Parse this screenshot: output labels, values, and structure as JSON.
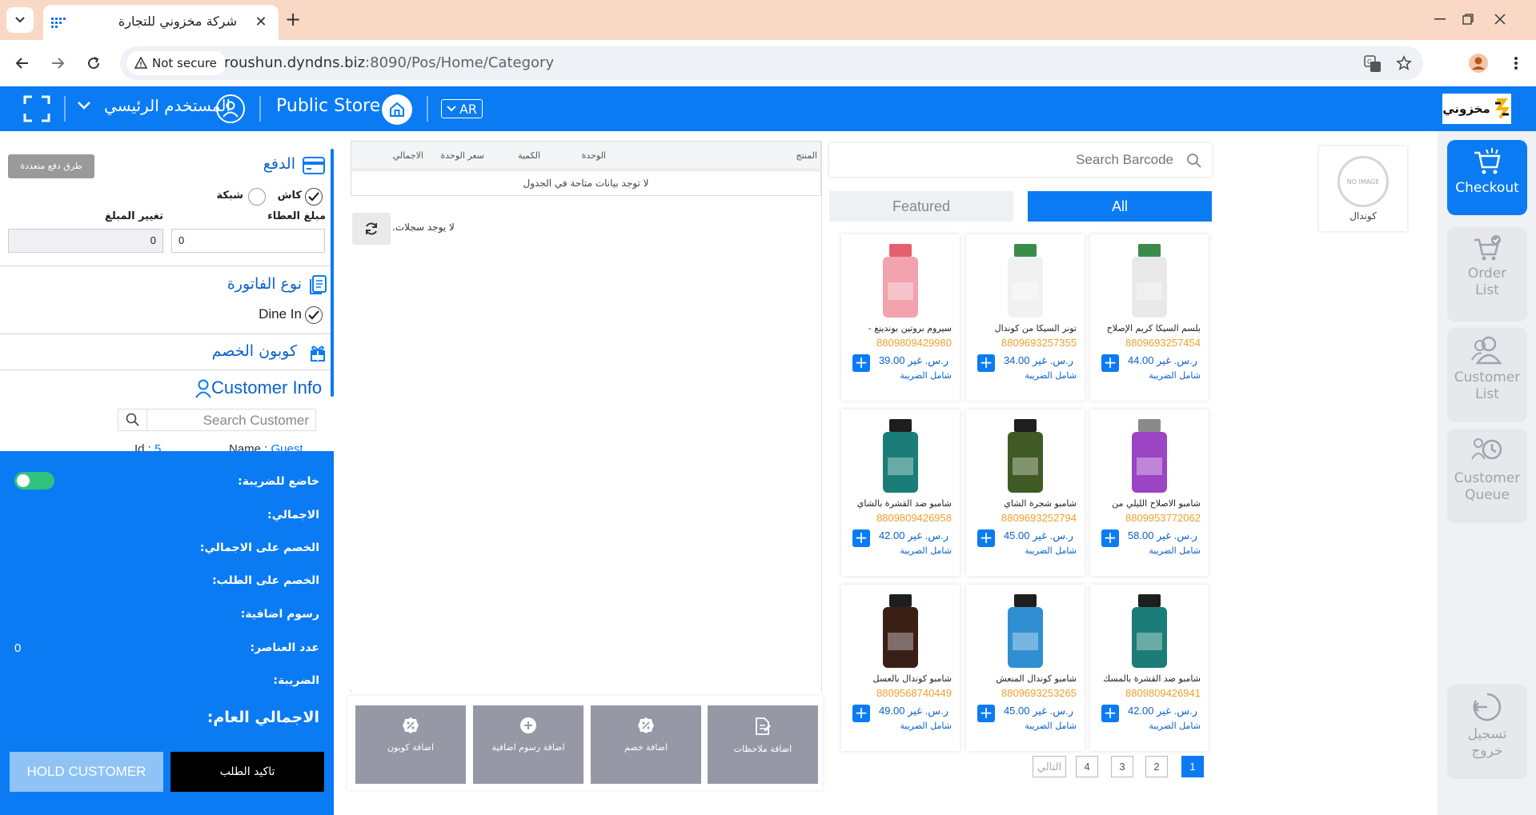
{
  "browser": {
    "tab_title": "شركة مخزوني للتجارة",
    "security_label": "Not secure",
    "url_host": "roushun.dyndns.biz",
    "url_path": ":8090/Pos/Home/Category"
  },
  "header": {
    "user_name": "المستخدم الرئيسي",
    "store_name": "Public Store",
    "language": "AR",
    "brand_name": "مخزوني",
    "accent_color": "#0a7bf3"
  },
  "sidebar": {
    "checkout": "Checkout",
    "order_list_1": "Order",
    "order_list_2": "List",
    "customer_list_1": "Customer",
    "customer_list_2": "List",
    "customer_queue_1": "Customer",
    "customer_queue_2": "Queue",
    "logout_1": "تسجيل",
    "logout_2": "خروج"
  },
  "category": {
    "placeholder_text": "NO IMAGE",
    "label": "كوندال"
  },
  "search": {
    "placeholder": "Search Barcode"
  },
  "filters": {
    "featured": "Featured",
    "all": "All"
  },
  "currency_label": "ر.س. غير",
  "vat_label": "شامل الضريبة",
  "products": [
    {
      "name": "بلسم السيكا كريم الإصلاح",
      "code": "8809693257454",
      "price": "44.00",
      "color": "#e9e9e9",
      "cap": "#3b8c4a"
    },
    {
      "name": "تونر السيكا من كوندال",
      "code": "8809693257355",
      "price": "34.00",
      "color": "#f1f1f1",
      "cap": "#3b8c4a"
    },
    {
      "name": "سيروم بروتين بوندينغ -",
      "code": "8809809429980",
      "price": "39.00",
      "color": "#f2a3ae",
      "cap": "#e5606f"
    },
    {
      "name": "شامبو الاصلاح الليلي من",
      "code": "8809953772062",
      "price": "58.00",
      "color": "#9b44c4",
      "cap": "#8a8a8a"
    },
    {
      "name": "شامبو شجرة الشاي",
      "code": "8809693252794",
      "price": "45.00",
      "color": "#3f5a24",
      "cap": "#1e1e1e"
    },
    {
      "name": "شامبو ضد القشرة بالشاي",
      "code": "8809809426958",
      "price": "42.00",
      "color": "#1a7d78",
      "cap": "#1e1e1e"
    },
    {
      "name": "شامبو ضد القشرة بالمسك",
      "code": "8809809426941",
      "price": "42.00",
      "color": "#1a7d78",
      "cap": "#1e1e1e"
    },
    {
      "name": "شامبو كوندال المنعش",
      "code": "8809693253265",
      "price": "45.00",
      "color": "#2f8fd0",
      "cap": "#1e1e1e"
    },
    {
      "name": "شامبو كوندال بالعسل",
      "code": "8809568740449",
      "price": "49.00",
      "color": "#3a1f17",
      "cap": "#1e1e1e"
    }
  ],
  "pagination": {
    "p1": "1",
    "p2": "2",
    "p3": "3",
    "p4": "4",
    "next": "التالي"
  },
  "cart": {
    "col_product": "المنتج",
    "col_unit": "الوحدة",
    "col_qty": "الكمية",
    "col_unit_price": "سعر الوحدة",
    "col_total": "الاجمالي",
    "empty_message": "لا توجد بيانات متاحة في الجدول",
    "no_records": "لا يوجد سجلات."
  },
  "actions": {
    "add_notes": "اضافة ملاحظات",
    "add_discount": "اضافة خصم",
    "add_fees": "اضافة رسوم اضافية",
    "add_coupon": "اضافة كوبون"
  },
  "payment": {
    "title": "الدفع",
    "multi_button": "طرق دفع متعددة",
    "cash": "كاش",
    "network": "شبكة",
    "tendered_label": "مبلغ العطاء",
    "change_label": "تغيير المبلغ",
    "tendered_value": "0",
    "change_value": "0"
  },
  "invoice": {
    "title": "نوع الفاتورة",
    "dine_in": "Dine In"
  },
  "coupon": {
    "title": "كوبون الخصم"
  },
  "customer": {
    "title": "Customer Info",
    "search_placeholder": "Search Customer",
    "id_label": "Id : ",
    "id_value": "5",
    "name_label": "Name : ",
    "name_value": "Guest"
  },
  "summary": {
    "taxable": "خاضع للضريبة:",
    "total": "الاجمالي:",
    "discount_total": "الخصم على الاجمالي:",
    "discount_order": "الخصم على الطلب:",
    "extra_fees": "رسوم اضافية:",
    "item_count": "عدد العناصر:",
    "item_count_value": "0",
    "tax": "الضريبة:",
    "grand_total": "الاجمالي العام:",
    "hold_button": "HOLD CUSTOMER",
    "confirm_button": "تاكيد الطلب"
  }
}
